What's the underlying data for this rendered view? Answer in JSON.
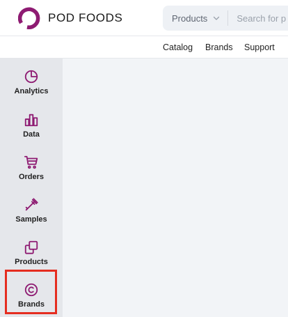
{
  "brand": {
    "name": "POD FOODS",
    "logo_icon": "pod-foods-logo-icon",
    "accent": "#8e1b72"
  },
  "search": {
    "scope_label": "Products",
    "scope_icon": "chevron-down-icon",
    "placeholder": "Search for p"
  },
  "subnav": {
    "catalog": "Catalog",
    "brands": "Brands",
    "support": "Support"
  },
  "sidebar": {
    "items": [
      {
        "label": "Analytics",
        "icon": "pie-chart-icon"
      },
      {
        "label": "Data",
        "icon": "bar-chart-icon"
      },
      {
        "label": "Orders",
        "icon": "cart-icon"
      },
      {
        "label": "Samples",
        "icon": "pipette-icon"
      },
      {
        "label": "Products",
        "icon": "copy-icon"
      },
      {
        "label": "Brands",
        "icon": "copyright-icon"
      }
    ],
    "selected": "Brands",
    "icon_color": "#8e1b72",
    "highlight_color": "#e52d20"
  }
}
